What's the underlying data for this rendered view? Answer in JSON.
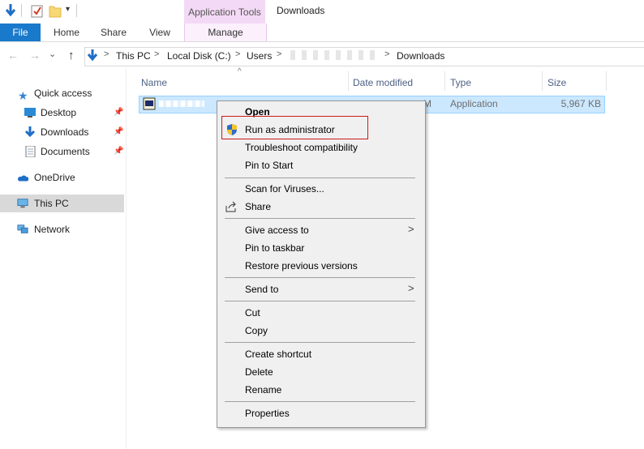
{
  "ribbon": {
    "contextual_group": "Application Tools",
    "window_title": "Downloads",
    "tabs": [
      {
        "label": "File"
      },
      {
        "label": "Home"
      },
      {
        "label": "Share"
      },
      {
        "label": "View"
      },
      {
        "label": "Manage"
      }
    ]
  },
  "address": {
    "crumbs": [
      "This PC",
      "Local Disk (C:)",
      "Users",
      "Downloads"
    ],
    "separator": ">"
  },
  "nav_pane": {
    "quick_access": "Quick access",
    "desktop": "Desktop",
    "downloads": "Downloads",
    "documents": "Documents",
    "onedrive": "OneDrive",
    "this_pc": "This PC",
    "network": "Network"
  },
  "columns": {
    "name": "Name",
    "date_modified": "Date modified",
    "type": "Type",
    "size": "Size"
  },
  "file": {
    "date_fragment": "M",
    "type": "Application",
    "size": "5,967 KB"
  },
  "context_menu": {
    "open": "Open",
    "run_as_admin": "Run as administrator",
    "troubleshoot": "Troubleshoot compatibility",
    "pin_start": "Pin to Start",
    "scan": "Scan for Viruses...",
    "share": "Share",
    "give_access": "Give access to",
    "pin_taskbar": "Pin to taskbar",
    "restore": "Restore previous versions",
    "send_to": "Send to",
    "cut": "Cut",
    "copy": "Copy",
    "create_shortcut": "Create shortcut",
    "delete": "Delete",
    "rename": "Rename",
    "properties": "Properties"
  },
  "colors": {
    "file_tab": "#1979ca",
    "contextual_tab": "#f3d9f5",
    "selection": "#cce8ff",
    "highlight_box": "#d0181b"
  },
  "icons": [
    "down-arrow-icon",
    "properties-icon",
    "folder-icon",
    "customize-qat-icon",
    "back-icon",
    "forward-icon",
    "up-icon",
    "star-icon",
    "desktop-icon",
    "downloads-icon",
    "documents-icon",
    "pin-icon",
    "onedrive-icon",
    "this-pc-icon",
    "network-icon",
    "sort-up-icon",
    "app-icon",
    "uac-shield-icon",
    "share-icon",
    "chevron-right-icon"
  ]
}
